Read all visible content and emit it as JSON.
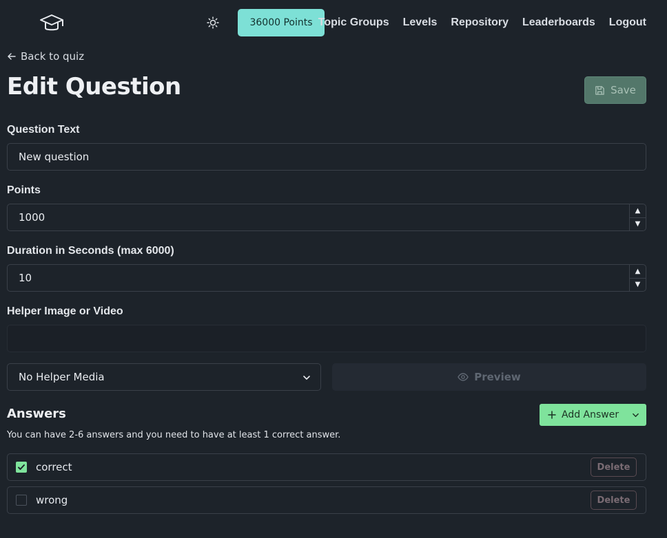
{
  "nav": {
    "points": "36000 Points",
    "links": [
      "Topic Groups",
      "Levels",
      "Repository",
      "Leaderboards",
      "Logout"
    ]
  },
  "page": {
    "back_label": "Back to quiz",
    "title": "Edit Question",
    "save_label": "Save"
  },
  "form": {
    "question_label": "Question Text",
    "question_value": "New question",
    "points_label": "Points",
    "points_value": "1000",
    "duration_label": "Duration in Seconds (max 6000)",
    "duration_value": "10",
    "media_label": "Helper Image or Video",
    "media_value": "",
    "media_type_selected": "No Helper Media",
    "preview_label": "Preview"
  },
  "answers": {
    "title": "Answers",
    "add_label": "Add Answer",
    "hint": "You can have 2-6 answers and you need to have at least 1 correct answer.",
    "delete_label": "Delete",
    "items": [
      {
        "text": "correct",
        "checked": true
      },
      {
        "text": "wrong",
        "checked": false
      }
    ]
  },
  "colors": {
    "background": "#1d232a",
    "accent_teal": "#7de0d6",
    "accent_green": "#7fe39c",
    "save_bg": "#53776a"
  },
  "icons": {
    "logo": "graduation-cap-icon",
    "theme": "sun-icon",
    "back": "arrow-left-icon",
    "save": "floppy-disk-icon",
    "select": "chevron-down-icon",
    "preview": "eye-icon",
    "add": "plus-icon",
    "check": "check-icon"
  }
}
